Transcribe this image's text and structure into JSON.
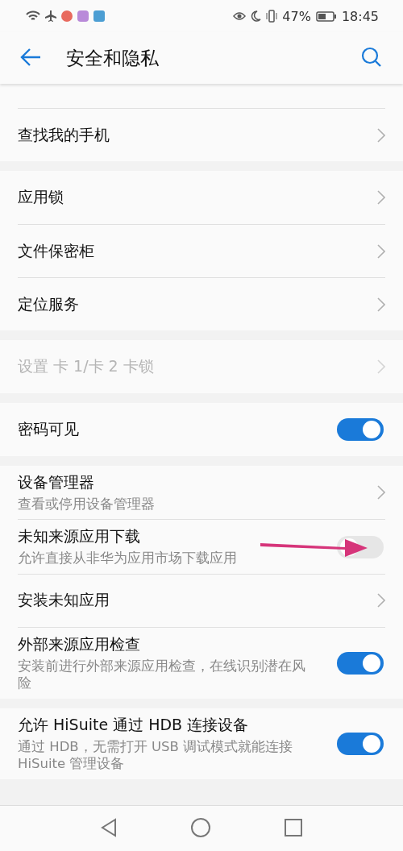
{
  "status_bar": {
    "battery": "47%",
    "time": "18:45"
  },
  "header": {
    "title": "安全和隐私"
  },
  "sections": [
    {
      "items": [
        {
          "kind": "hidden"
        },
        {
          "kind": "link",
          "title": "查找我的手机",
          "disabled": false
        }
      ]
    },
    {
      "items": [
        {
          "kind": "link",
          "title": "应用锁",
          "disabled": false
        },
        {
          "kind": "link",
          "title": "文件保密柜",
          "disabled": false
        },
        {
          "kind": "link",
          "title": "定位服务",
          "disabled": false
        }
      ]
    },
    {
      "items": [
        {
          "kind": "link",
          "title": "设置 卡 1/卡 2 卡锁",
          "disabled": true
        }
      ]
    },
    {
      "items": [
        {
          "kind": "toggle",
          "title": "密码可见",
          "on": true,
          "disabled": false
        }
      ]
    },
    {
      "items": [
        {
          "kind": "link",
          "title": "设备管理器",
          "subtitle": "查看或停用设备管理器",
          "disabled": false
        },
        {
          "kind": "toggle",
          "title": "未知来源应用下载",
          "subtitle": "允许直接从非华为应用市场下载应用",
          "on": false,
          "disabled": false,
          "annotated": true
        },
        {
          "kind": "link",
          "title": "安装未知应用",
          "disabled": false
        },
        {
          "kind": "toggle",
          "title": "外部来源应用检查",
          "subtitle": "安装前进行外部来源应用检查，在线识别潜在风险",
          "on": true,
          "disabled": false
        }
      ]
    },
    {
      "items": [
        {
          "kind": "toggle",
          "title": "允许 HiSuite 通过 HDB 连接设备",
          "subtitle": "通过 HDB，无需打开 USB 调试模式就能连接 HiSuite 管理设备",
          "on": true,
          "disabled": false
        }
      ]
    }
  ]
}
